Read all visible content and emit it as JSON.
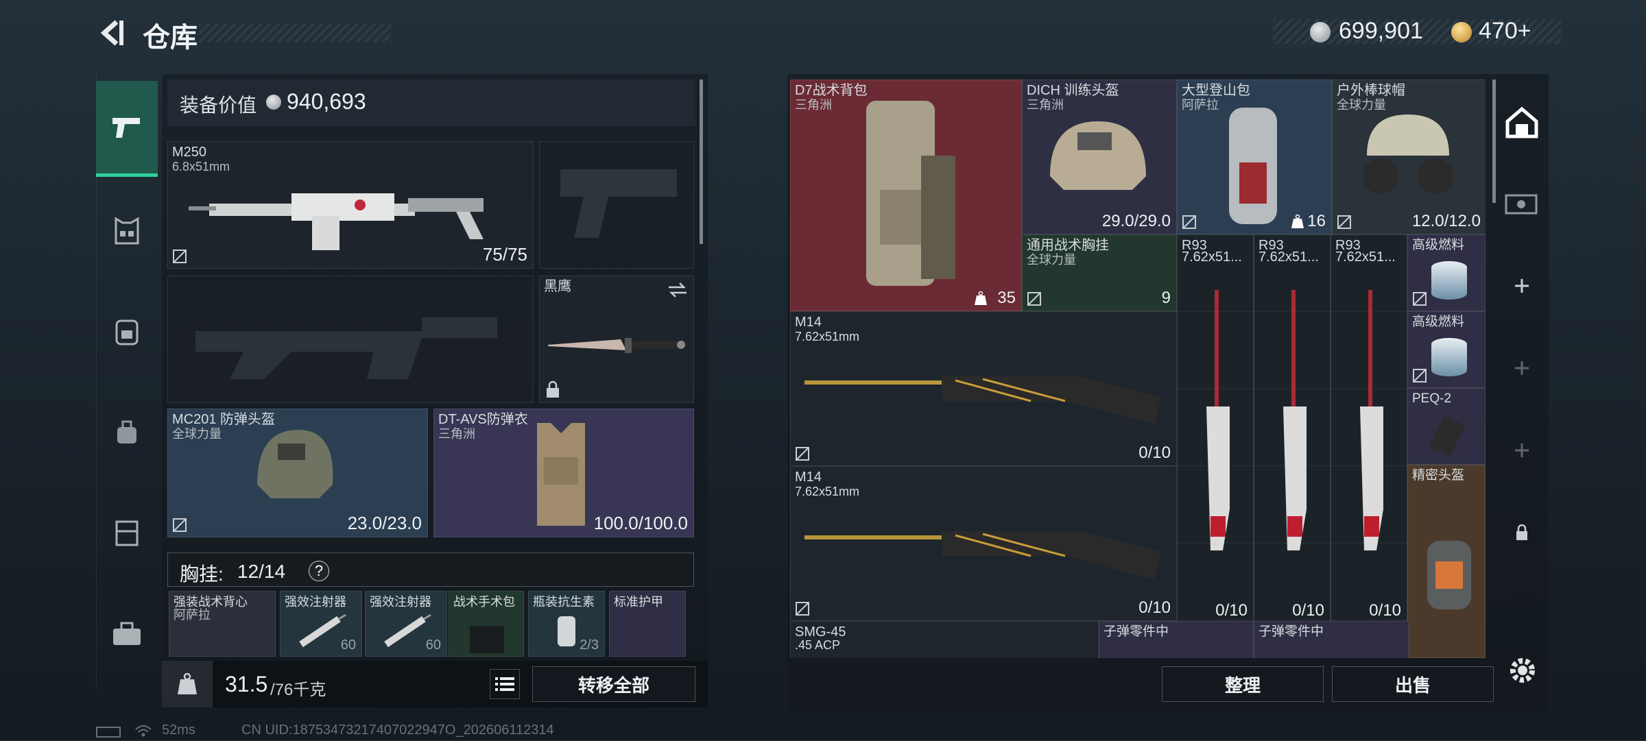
{
  "header": {
    "title": "仓库",
    "currency_1": "699,901",
    "currency_2": "470+"
  },
  "left": {
    "equip_value_label": "装备价值",
    "equip_value": "940,693",
    "primary": {
      "name": "M250",
      "caliber": "6.8x51mm",
      "ammo": "75/75"
    },
    "melee": {
      "name": "黑鹰"
    },
    "helmet": {
      "name": "MC201 防弹头盔",
      "map": "全球力量",
      "dur": "23.0/23.0"
    },
    "armor": {
      "name": "DT-AVS防弹衣",
      "map": "三角洲",
      "dur": "100.0/100.0"
    },
    "chest_rig_label": "胸挂:",
    "chest_rig_cap": "12/14",
    "help": "?",
    "rig_items": [
      {
        "name": "强装战术背心",
        "sub": "阿萨拉",
        "count": ""
      },
      {
        "name": "强效注射器",
        "sub": "",
        "count": "60"
      },
      {
        "name": "强效注射器",
        "sub": "",
        "count": "60"
      },
      {
        "name": "战术手术包",
        "sub": "",
        "count": ""
      },
      {
        "name": "瓶装抗生素",
        "sub": "",
        "count": "2/3"
      },
      {
        "name": "标准护甲",
        "sub": "",
        "count": ""
      }
    ],
    "weight": "31.5",
    "weight_max": "/76千克",
    "transfer_all": "转移全部"
  },
  "stash": {
    "items": {
      "backpack": {
        "name": "D7战术背包",
        "map": "三角洲",
        "count": "35"
      },
      "dich": {
        "name": "DICH 训练头盔",
        "map": "三角洲",
        "dur": "29.0/29.0"
      },
      "climb": {
        "name": "大型登山包",
        "map": "阿萨拉",
        "count": "16"
      },
      "cap": {
        "name": "户外棒球帽",
        "map": "全球力量",
        "dur": "12.0/12.0"
      },
      "rig": {
        "name": "通用战术胸挂",
        "map": "全球力量",
        "count": "9"
      },
      "r93_a": {
        "name": "R93",
        "cal": "7.62x51..."
      },
      "r93_b": {
        "name": "R93",
        "cal": "7.62x51..."
      },
      "r93_c": {
        "name": "R93",
        "cal": "7.62x51..."
      },
      "fuel1": {
        "name": "高级燃料"
      },
      "fuel2": {
        "name": "高级燃料"
      },
      "peq": {
        "name": "PEQ-2"
      },
      "precise_helmet": {
        "name": "精密头盔"
      },
      "m14_a": {
        "name": "M14",
        "cal": "7.62x51mm",
        "ammo": "0/10"
      },
      "m14_b": {
        "name": "M14",
        "cal": "7.62x51mm",
        "ammo": "0/10"
      },
      "r93_ammo_a": "0/10",
      "r93_ammo_b": "0/10",
      "r93_ammo_c": "0/10",
      "smg": {
        "name": "SMG-45",
        "cal": ".45 ACP"
      },
      "parts1": {
        "name": "子弹零件中"
      },
      "parts2": {
        "name": "子弹零件中"
      }
    },
    "sort": "整理",
    "sell": "出售"
  },
  "status": {
    "ping": "52ms",
    "uid": "CN UID:18753473217407022947O_202606112314"
  },
  "colors": {
    "accent_green": "#2fd19b",
    "backpack_bg": "#6b2b34",
    "blue_bg": "#2c3e52",
    "purple_bg": "#383654",
    "green_bg": "#22372e",
    "brown_bg": "#4b3a2c"
  }
}
